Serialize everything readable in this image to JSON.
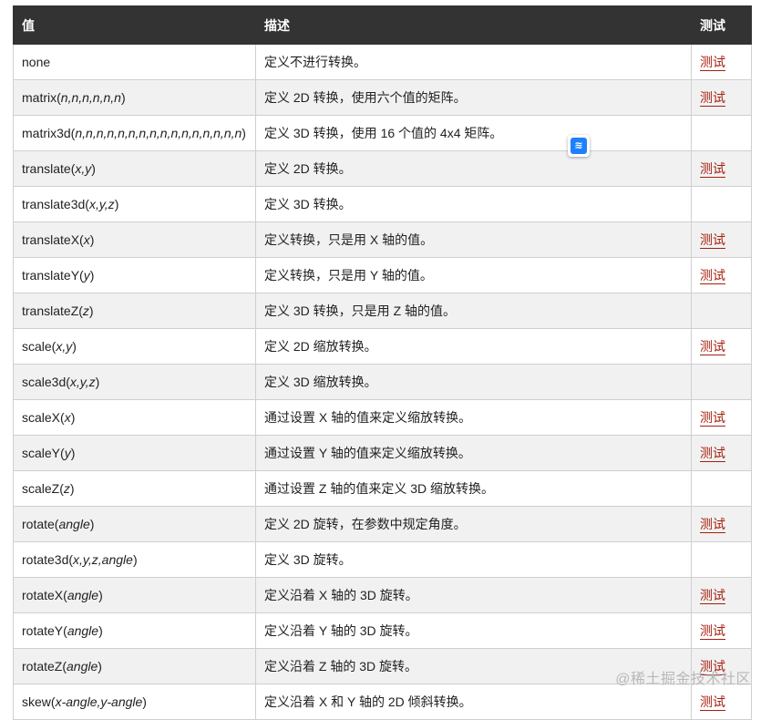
{
  "table": {
    "headers": [
      "值",
      "描述",
      "测试"
    ],
    "rows": [
      {
        "fn": "none",
        "args": "",
        "desc": "定义不进行转换。",
        "test": "测试"
      },
      {
        "fn": "matrix(",
        "args": "n,n,n,n,n,n",
        "desc": "定义 2D 转换，使用六个值的矩阵。",
        "test": "测试"
      },
      {
        "fn": "matrix3d(",
        "args": "n,n,n,n,n,n,n,n,n,n,n,n,n,n,n,n",
        "desc": "定义 3D 转换，使用 16 个值的 4x4 矩阵。",
        "test": ""
      },
      {
        "fn": "translate(",
        "args": "x,y",
        "desc": "定义 2D 转换。",
        "test": "测试"
      },
      {
        "fn": "translate3d(",
        "args": "x,y,z",
        "desc": "定义 3D 转换。",
        "test": ""
      },
      {
        "fn": "translateX(",
        "args": "x",
        "desc": "定义转换，只是用 X 轴的值。",
        "test": "测试"
      },
      {
        "fn": "translateY(",
        "args": "y",
        "desc": "定义转换，只是用 Y 轴的值。",
        "test": "测试"
      },
      {
        "fn": "translateZ(",
        "args": "z",
        "desc": "定义 3D 转换，只是用 Z 轴的值。",
        "test": ""
      },
      {
        "fn": "scale(",
        "args": "x,y",
        "desc": "定义 2D 缩放转换。",
        "test": "测试"
      },
      {
        "fn": "scale3d(",
        "args": "x,y,z",
        "desc": "定义 3D 缩放转换。",
        "test": ""
      },
      {
        "fn": "scaleX(",
        "args": "x",
        "desc": "通过设置 X 轴的值来定义缩放转换。",
        "test": "测试"
      },
      {
        "fn": "scaleY(",
        "args": "y",
        "desc": "通过设置 Y 轴的值来定义缩放转换。",
        "test": "测试"
      },
      {
        "fn": "scaleZ(",
        "args": "z",
        "desc": "通过设置 Z 轴的值来定义 3D 缩放转换。",
        "test": ""
      },
      {
        "fn": "rotate(",
        "args": "angle",
        "desc": "定义 2D 旋转，在参数中规定角度。",
        "test": "测试"
      },
      {
        "fn": "rotate3d(",
        "args": "x,y,z,angle",
        "desc": "定义 3D 旋转。",
        "test": ""
      },
      {
        "fn": "rotateX(",
        "args": "angle",
        "desc": "定义沿着 X 轴的 3D 旋转。",
        "test": "测试"
      },
      {
        "fn": "rotateY(",
        "args": "angle",
        "desc": "定义沿着 Y 轴的 3D 旋转。",
        "test": "测试"
      },
      {
        "fn": "rotateZ(",
        "args": "angle",
        "desc": "定义沿着 Z 轴的 3D 旋转。",
        "test": "测试"
      },
      {
        "fn": "skew(",
        "args": "x-angle,y-angle",
        "desc": "定义沿着 X 和 Y 轴的 2D 倾斜转换。",
        "test": "测试"
      }
    ]
  },
  "floating_icon": {
    "icon": "bookmark-app-icon",
    "glyph": "≋"
  },
  "watermark": "@稀土掘金技术社区",
  "colors": {
    "header_bg": "#333333",
    "link": "#a4200f",
    "stripe": "#f1f1f1"
  }
}
